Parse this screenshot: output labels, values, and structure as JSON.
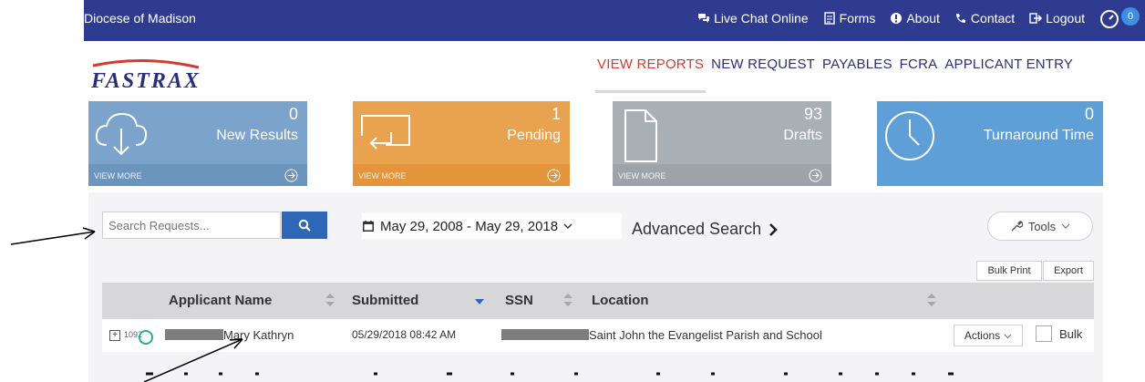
{
  "topbar": {
    "org_name": "Diocese of Madison",
    "links": [
      {
        "label": "Live Chat Online",
        "icon": "chat-icon"
      },
      {
        "label": "Forms",
        "icon": "document-icon"
      },
      {
        "label": "About",
        "icon": "info-icon"
      },
      {
        "label": "Contact",
        "icon": "phone-icon"
      },
      {
        "label": "Logout",
        "icon": "logout-icon"
      }
    ],
    "notification_count": "0"
  },
  "logo_text": "FASTRAX",
  "nav": {
    "items": [
      "VIEW REPORTS",
      "NEW REQUEST",
      "PAYABLES",
      "FCRA",
      "APPLICANT ENTRY"
    ],
    "active": "VIEW REPORTS"
  },
  "tiles": [
    {
      "count": "0",
      "label": "New Results",
      "view_more": "VIEW MORE",
      "color": "#7ba3cb"
    },
    {
      "count": "1",
      "label": "Pending",
      "view_more": "VIEW MORE",
      "color": "#e9a24d"
    },
    {
      "count": "93",
      "label": "Drafts",
      "view_more": "VIEW MORE",
      "color": "#a9b0b4"
    },
    {
      "count": "0",
      "label": "Turnaround Time",
      "color": "#5f9fd8"
    }
  ],
  "search": {
    "placeholder": "Search Requests..."
  },
  "date_range": "May 29, 2008 - May 29, 2018",
  "advanced_search": "Advanced Search",
  "tools_label": "Tools",
  "bulk_print_label": "Bulk Print",
  "export_label": "Export",
  "table": {
    "headers": [
      "Applicant Name",
      "Submitted",
      "SSN",
      "Location"
    ],
    "rows": [
      {
        "id_prefix": "1092",
        "name": "Mary Kathryn",
        "submitted": "05/29/2018 08:42 AM",
        "location": "Saint John the Evangelist Parish and School",
        "actions": "Actions",
        "bulk": "Bulk"
      }
    ]
  }
}
